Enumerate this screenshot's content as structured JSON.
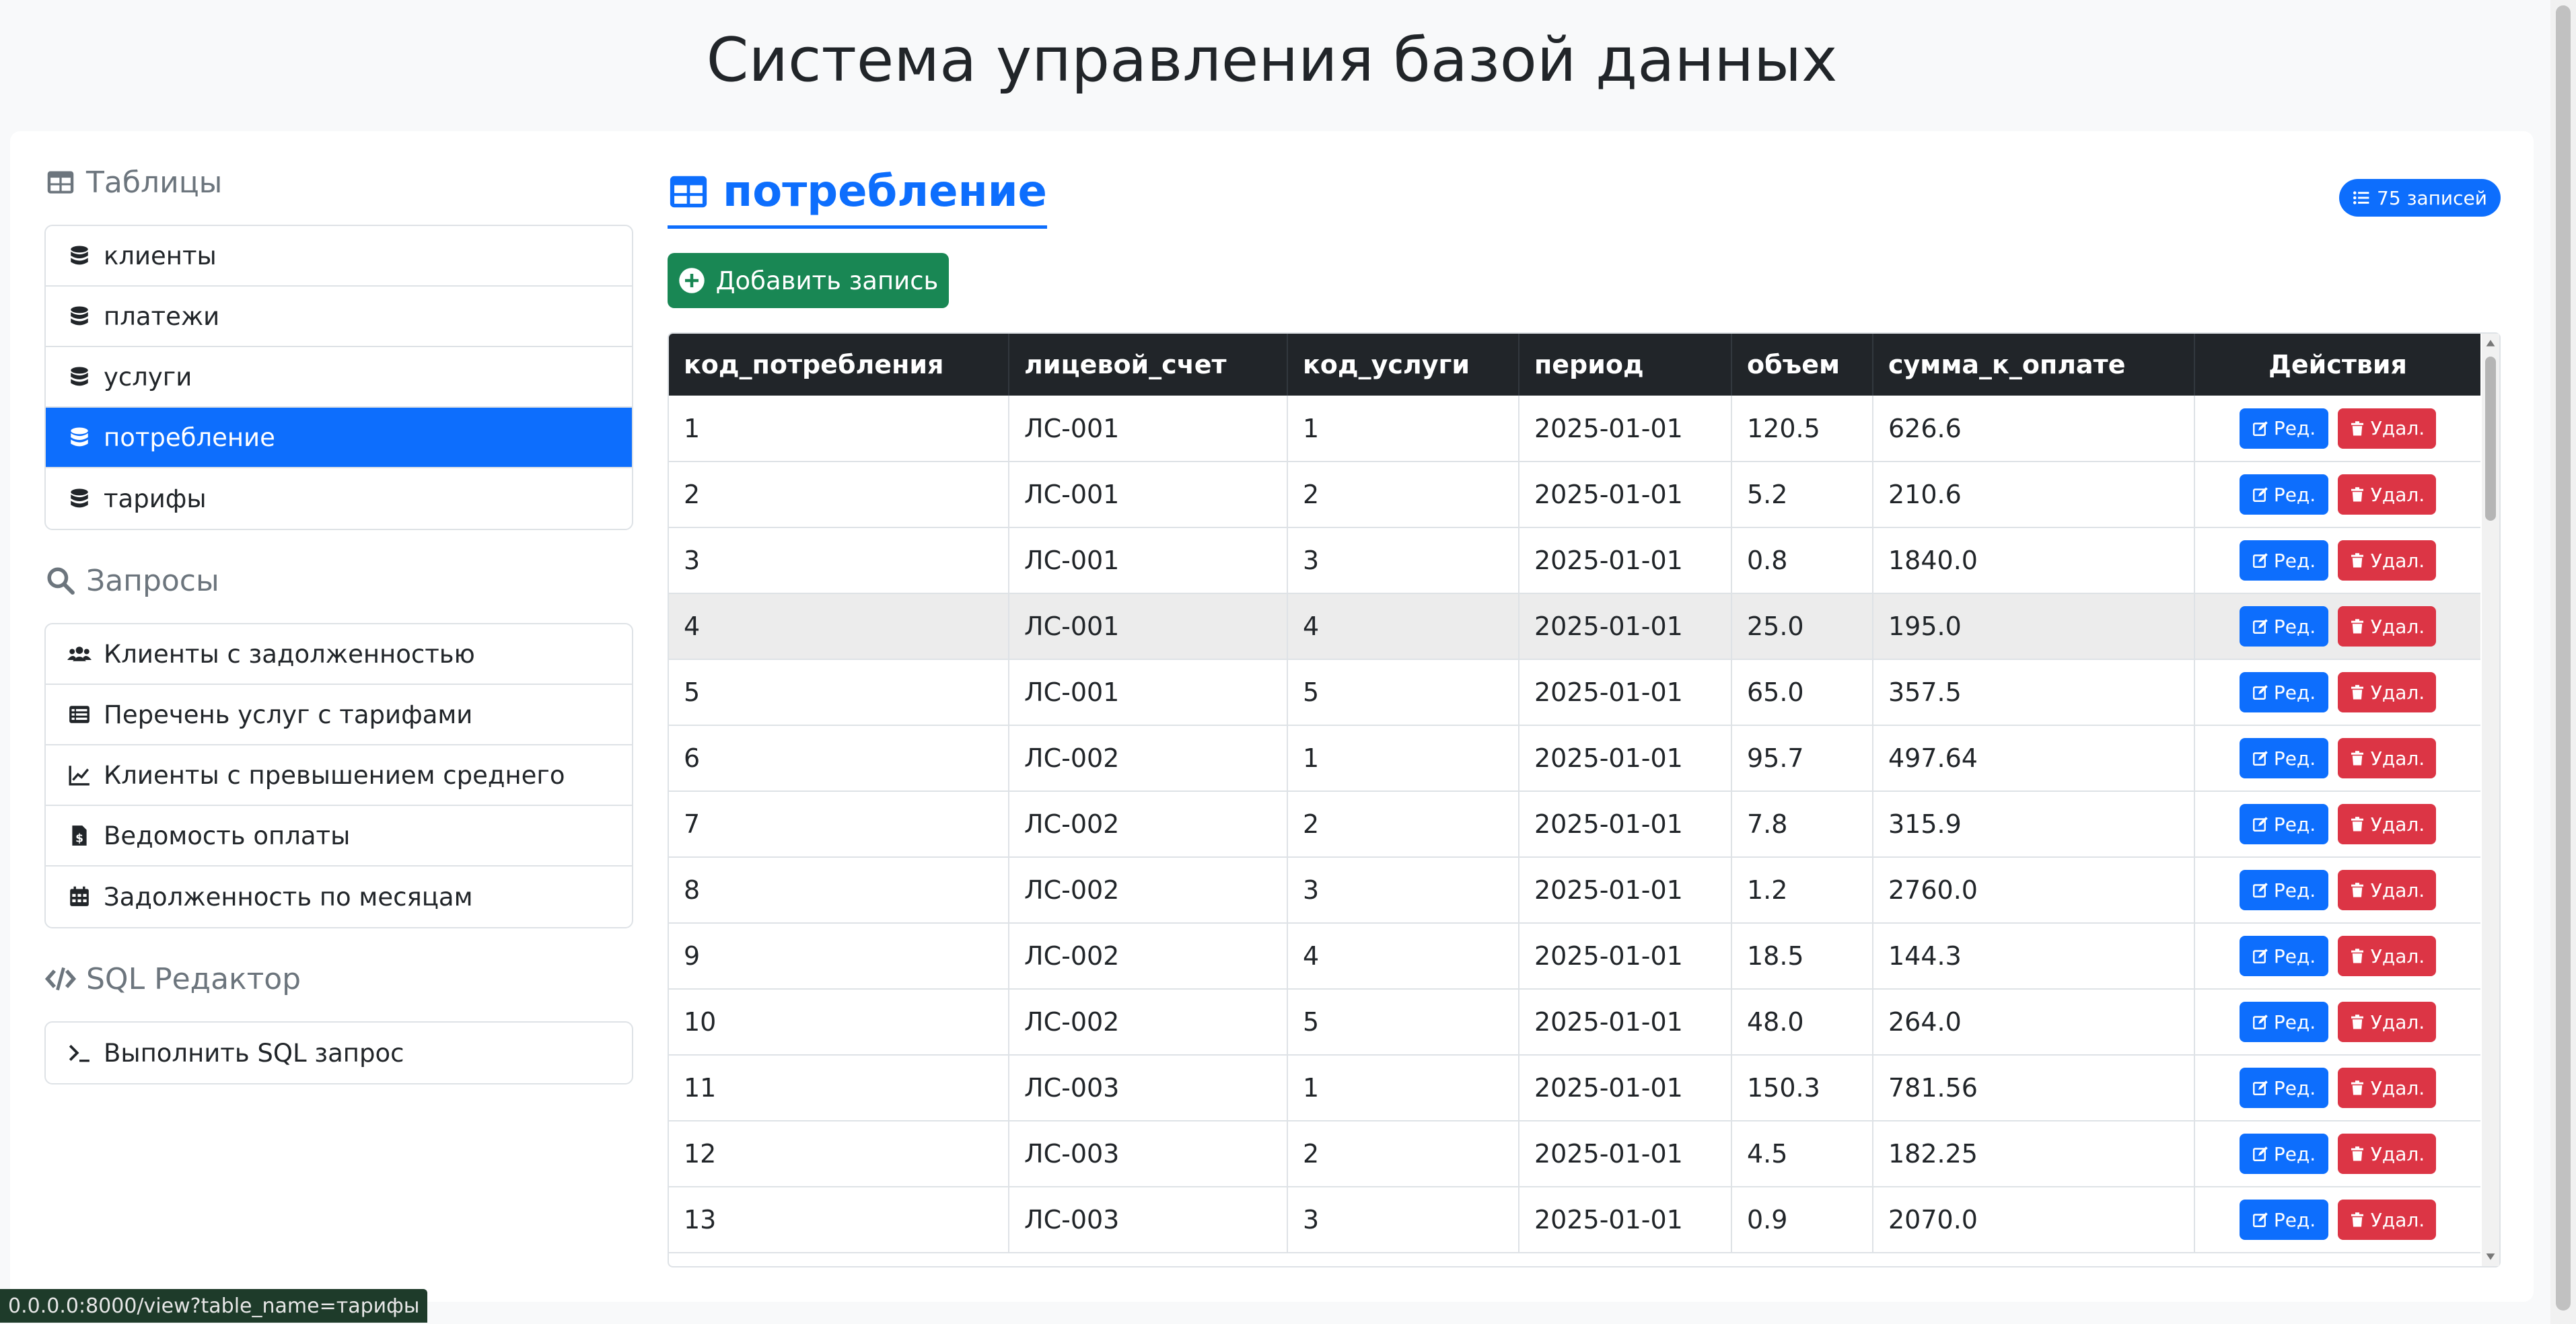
{
  "header": {
    "title": "Система управления базой данных"
  },
  "sidebar": {
    "tables_heading": "Таблицы",
    "tables": [
      {
        "label": "клиенты",
        "active": false
      },
      {
        "label": "платежи",
        "active": false
      },
      {
        "label": "услуги",
        "active": false
      },
      {
        "label": "потребление",
        "active": true
      },
      {
        "label": "тарифы",
        "active": false
      }
    ],
    "queries_heading": "Запросы",
    "queries": [
      {
        "label": "Клиенты с задолженностью",
        "icon": "users-icon"
      },
      {
        "label": "Перечень услуг с тарифами",
        "icon": "list-icon"
      },
      {
        "label": "Клиенты с превышением среднего",
        "icon": "chart-line-icon"
      },
      {
        "label": "Ведомость оплаты",
        "icon": "file-invoice-icon"
      },
      {
        "label": "Задолженность по месяцам",
        "icon": "calendar-icon"
      }
    ],
    "sql_heading": "SQL Редактор",
    "sql_items": [
      {
        "label": "Выполнить SQL запрос",
        "icon": "terminal-icon"
      }
    ]
  },
  "main": {
    "title": "потребление",
    "count_badge": "75 записей",
    "add_button": "Добавить запись",
    "columns": [
      "код_потребления",
      "лицевой_счет",
      "код_услуги",
      "период",
      "объем",
      "сумма_к_оплате",
      "Действия"
    ],
    "edit_label": "Ред.",
    "delete_label": "Удал.",
    "rows": [
      [
        "1",
        "ЛС-001",
        "1",
        "2025-01-01",
        "120.5",
        "626.6"
      ],
      [
        "2",
        "ЛС-001",
        "2",
        "2025-01-01",
        "5.2",
        "210.6"
      ],
      [
        "3",
        "ЛС-001",
        "3",
        "2025-01-01",
        "0.8",
        "1840.0"
      ],
      [
        "4",
        "ЛС-001",
        "4",
        "2025-01-01",
        "25.0",
        "195.0"
      ],
      [
        "5",
        "ЛС-001",
        "5",
        "2025-01-01",
        "65.0",
        "357.5"
      ],
      [
        "6",
        "ЛС-002",
        "1",
        "2025-01-01",
        "95.7",
        "497.64"
      ],
      [
        "7",
        "ЛС-002",
        "2",
        "2025-01-01",
        "7.8",
        "315.9"
      ],
      [
        "8",
        "ЛС-002",
        "3",
        "2025-01-01",
        "1.2",
        "2760.0"
      ],
      [
        "9",
        "ЛС-002",
        "4",
        "2025-01-01",
        "18.5",
        "144.3"
      ],
      [
        "10",
        "ЛС-002",
        "5",
        "2025-01-01",
        "48.0",
        "264.0"
      ],
      [
        "11",
        "ЛС-003",
        "1",
        "2025-01-01",
        "150.3",
        "781.56"
      ],
      [
        "12",
        "ЛС-003",
        "2",
        "2025-01-01",
        "4.5",
        "182.25"
      ],
      [
        "13",
        "ЛС-003",
        "3",
        "2025-01-01",
        "0.9",
        "2070.0"
      ]
    ],
    "hovered_row": 3
  },
  "status_bar": {
    "url": "0.0.0.0:8000/view?table_name=тарифы"
  },
  "colors": {
    "primary": "#0d6efd",
    "success": "#198754",
    "danger": "#dc3545",
    "dark": "#212529"
  }
}
